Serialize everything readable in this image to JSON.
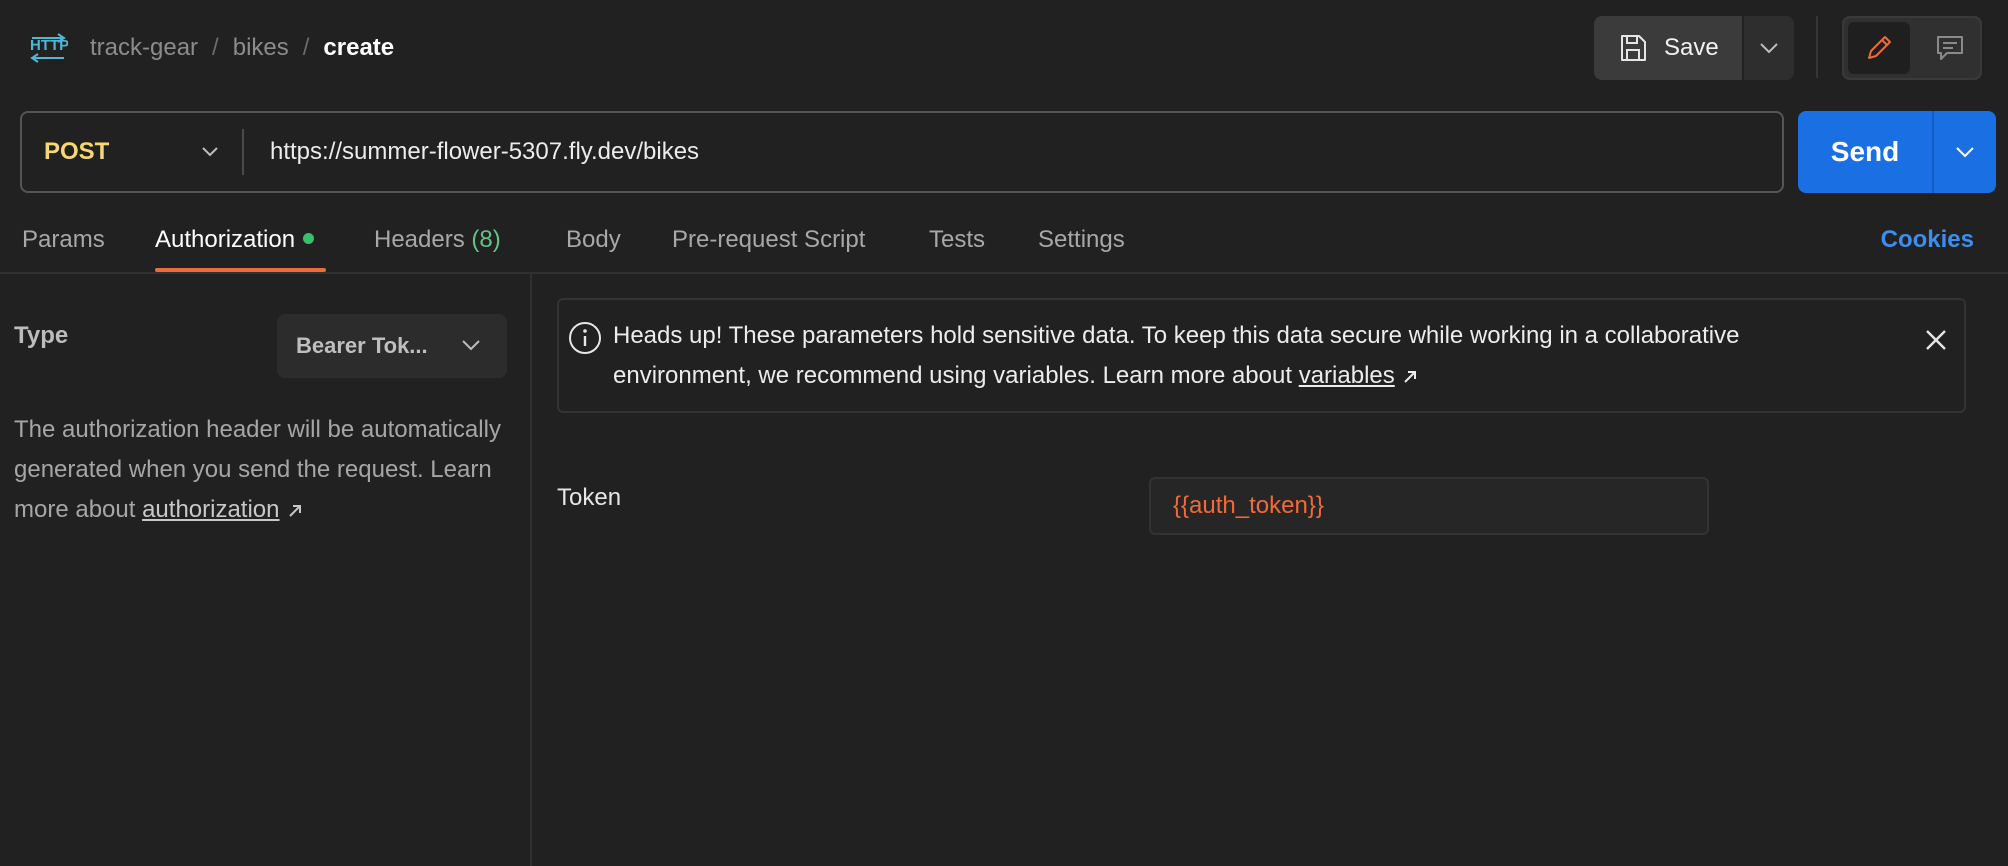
{
  "header": {
    "breadcrumb": [
      "track-gear",
      "bikes",
      "create"
    ],
    "separator": "/",
    "save_label": "Save"
  },
  "request": {
    "method": "POST",
    "url": "https://summer-flower-5307.fly.dev/bikes",
    "send_label": "Send"
  },
  "tabs": [
    {
      "label": "Params",
      "active": false
    },
    {
      "label": "Authorization",
      "active": true,
      "indicator": "green-dot"
    },
    {
      "label": "Headers",
      "count": "(8)",
      "active": false
    },
    {
      "label": "Body",
      "active": false
    },
    {
      "label": "Pre-request Script",
      "active": false
    },
    {
      "label": "Tests",
      "active": false
    },
    {
      "label": "Settings",
      "active": false
    }
  ],
  "cookies_label": "Cookies",
  "auth": {
    "type_label": "Type",
    "type_value": "Bearer Tok...",
    "help_text": "The authorization header will be automatically generated when you send the request. Learn more about",
    "help_link": "authorization"
  },
  "notice": {
    "text": "Heads up! These parameters hold sensitive data. To keep this data secure while working in a collaborative environment, we recommend using variables. Learn more about",
    "link": "variables"
  },
  "token": {
    "label": "Token",
    "value": "{{auth_token}}"
  },
  "colors": {
    "accent_orange": "#f06a3a",
    "send_blue": "#1a6fe3",
    "method_yellow": "#f7d774",
    "cookies_blue": "#3b8ef0",
    "indicator_green": "#3ac06a"
  },
  "icons": [
    "http-icon",
    "save-icon",
    "chevron-down-icon",
    "pencil-icon",
    "comment-icon",
    "info-icon",
    "close-icon",
    "external-link-icon"
  ]
}
